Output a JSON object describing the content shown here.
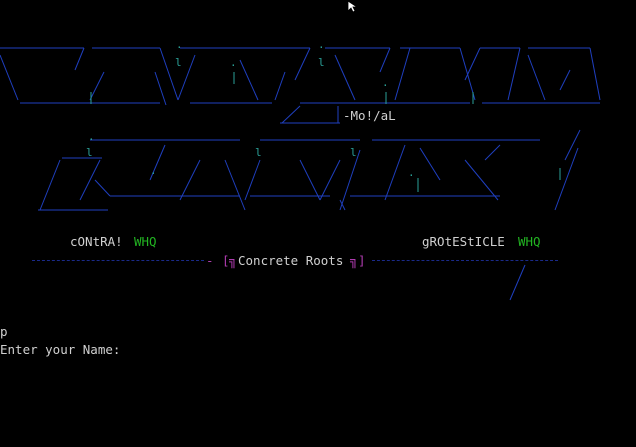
{
  "terminal": {
    "art_credit": "-Mo!/aL",
    "left_tag": {
      "name": "cONtRA!",
      "group": "WHQ"
    },
    "right_tag": {
      "name": "gROtEStICLE",
      "group": "WHQ"
    },
    "banner": {
      "left_bracket": "[",
      "left_mark": "╗",
      "title": "Concrete Roots",
      "right_mark": "╗",
      "right_bracket": "]",
      "dash": "-"
    },
    "prompt_echo": "p",
    "prompt_label": "Enter your Name:"
  },
  "colors": {
    "background": "#000000",
    "text": "#d0d0d0",
    "group_tag": "#22b522",
    "banner_bracket": "#b03cb0",
    "art_blue": "#1f3fbf",
    "art_cyan": "#2aa198"
  },
  "icons": {
    "cursor": "mouse-pointer-icon"
  }
}
